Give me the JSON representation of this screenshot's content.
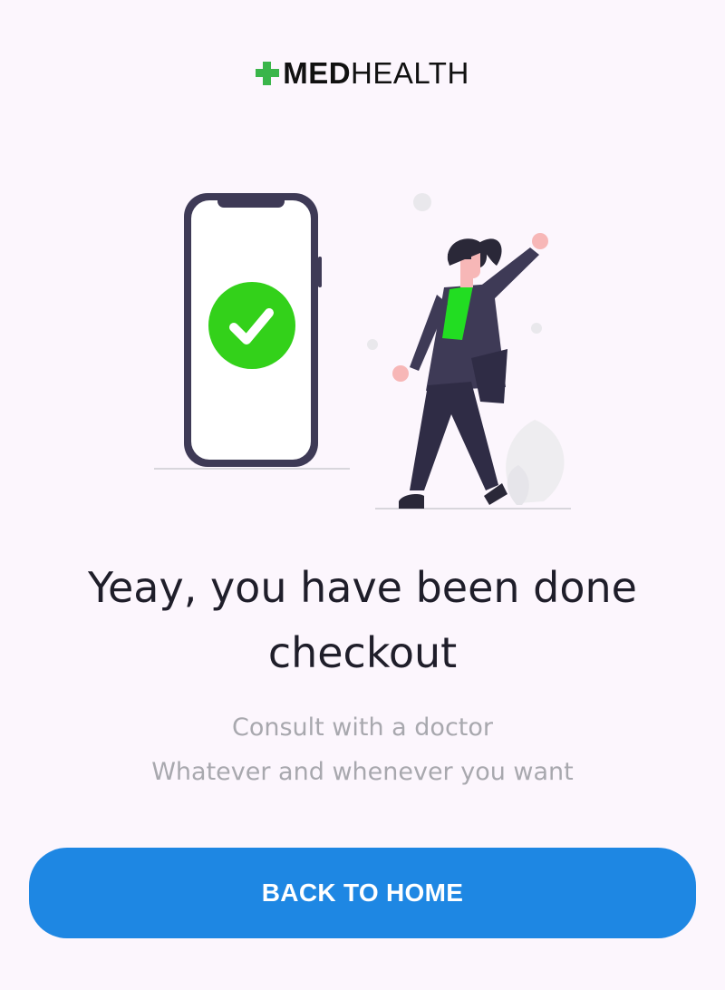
{
  "brand": {
    "name_bold": "MED",
    "name_light": "HEALTH",
    "accent_color": "#3ab54a"
  },
  "illustration": {
    "phone_icon": "check-circle-icon",
    "check_color": "#33d11a",
    "person_shirt_color": "#22dd22"
  },
  "message": {
    "title": "Yeay, you have been done checkout",
    "subtitle_line1": "Consult with a doctor",
    "subtitle_line2": "Whatever and whenever you want"
  },
  "actions": {
    "back_home_label": "BACK TO HOME",
    "button_color": "#1e87e3"
  }
}
